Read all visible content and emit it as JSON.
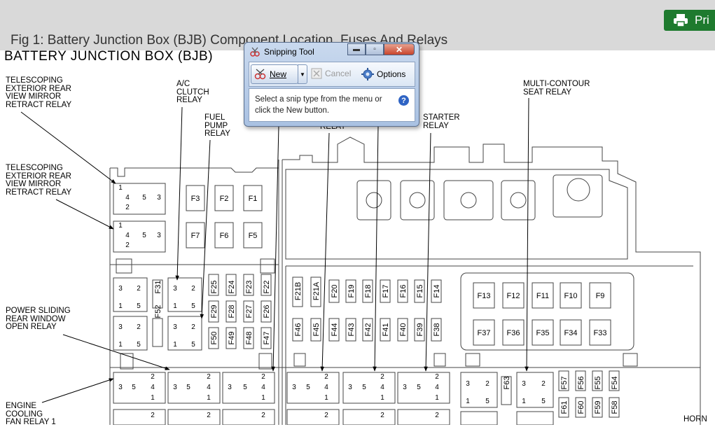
{
  "page": {
    "print_label": "Pri",
    "figure_caption": "Fig 1: Battery Junction Box (BJB) Component Location, Fuses And Relays"
  },
  "diagram": {
    "title": "BATTERY JUNCTION BOX (BJB)",
    "callouts": {
      "tele_1": "TELESCOPING\nEXTERIOR REAR\nVIEW MIRROR\nRETRACT RELAY",
      "tele_2": "TELESCOPING\nEXTERIOR REAR\nVIEW MIRROR\nRETRACT RELAY",
      "ac_clutch": "A/C\nCLUTCH\nRELAY",
      "fuel_pump": "FUEL\nPUMP\nRELAY",
      "relay_partial": "RELAY",
      "starter": "STARTER\nRELAY",
      "multi_contour": "MULTI-CONTOUR\nSEAT RELAY",
      "power_sliding": "POWER SLIDING\nREAR WINDOW\nOPEN RELAY",
      "engine_cooling": "ENGINE\nCOOLING\nFAN RELAY 1",
      "horn": "HORN"
    },
    "fuses": {
      "top_row1": [
        "F3",
        "F2",
        "F1"
      ],
      "top_row2": [
        "F7",
        "F6",
        "F5"
      ],
      "left_vertical_row1": [
        "F31",
        "F25",
        "F24",
        "F23",
        "F22"
      ],
      "left_vertical_row2": [
        "F52",
        "F29",
        "F28",
        "F27",
        "F26"
      ],
      "left_vertical_row3": [
        "F50",
        "F49",
        "F48",
        "F47"
      ],
      "mid_row1": [
        "F21B",
        "F21A",
        "F20",
        "F19",
        "F18",
        "F17",
        "F16",
        "F15",
        "F14"
      ],
      "mid_row2": [
        "F46",
        "F45",
        "F44",
        "F43",
        "F42",
        "F41",
        "F40",
        "F39",
        "F38"
      ],
      "right_row1": [
        "F13",
        "F12",
        "F11",
        "F10",
        "F9"
      ],
      "right_row2": [
        "F37",
        "F36",
        "F35",
        "F34",
        "F33"
      ],
      "bottom_right_row1": [
        "F63",
        "F57",
        "F56",
        "F55",
        "F54"
      ],
      "bottom_right_row2": [
        "F61",
        "F60",
        "F59",
        "F58"
      ]
    },
    "pins": {
      "one": "1",
      "two": "2",
      "three": "3",
      "four": "4",
      "five": "5"
    }
  },
  "snipping_tool": {
    "title": "Snipping Tool",
    "new_label": "New",
    "cancel_label": "Cancel",
    "options_label": "Options",
    "message": "Select a snip type from the menu or click the New button.",
    "help_glyph": "?"
  }
}
